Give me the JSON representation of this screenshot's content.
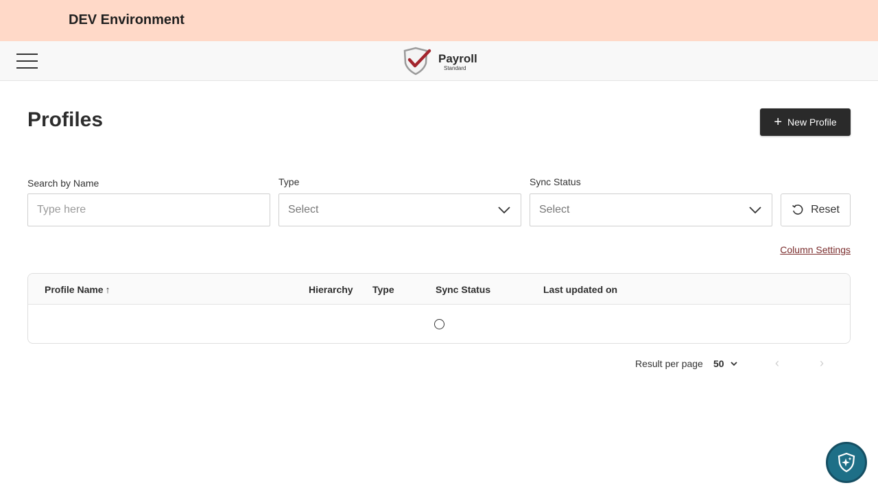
{
  "banner": {
    "text": "DEV Environment"
  },
  "header": {
    "logo_word": "Payroll",
    "logo_sub": "Standard"
  },
  "page": {
    "title": "Profiles",
    "new_button": "New Profile"
  },
  "filters": {
    "search_label": "Search by Name",
    "search_placeholder": "Type here",
    "type_label": "Type",
    "type_value": "Select",
    "sync_label": "Sync Status",
    "sync_value": "Select",
    "reset_label": "Reset"
  },
  "column_settings": "Column Settings",
  "table": {
    "columns": [
      "Profile Name",
      "Hierarchy",
      "Type",
      "Sync Status",
      "Last updated on"
    ],
    "sort_indicator": "↑",
    "rows": []
  },
  "pagination": {
    "label": "Result per page",
    "per_page": "50"
  },
  "colors": {
    "banner_bg": "#ffd9c8",
    "primary_button": "#2a2a2a",
    "link": "#7a2c2c",
    "fab": "#1e6f87"
  }
}
